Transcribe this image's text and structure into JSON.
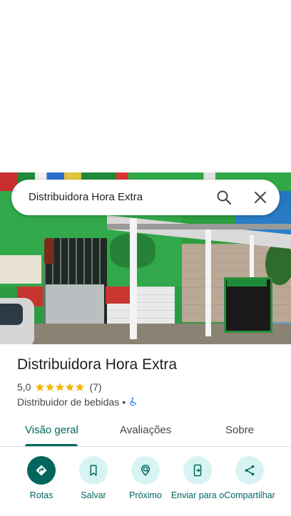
{
  "search": {
    "query": "Distribuidora Hora Extra"
  },
  "place": {
    "name": "Distribuidora Hora Extra",
    "rating": "5,0",
    "stars": 5,
    "review_count": "(7)",
    "category": "Distribuidor de bebidas",
    "separator": "•"
  },
  "tabs": [
    {
      "label": "Visão geral",
      "active": true
    },
    {
      "label": "Avaliações",
      "active": false
    },
    {
      "label": "Sobre",
      "active": false
    }
  ],
  "actions": [
    {
      "label": "Rotas",
      "icon": "directions-icon"
    },
    {
      "label": "Salvar",
      "icon": "bookmark-icon"
    },
    {
      "label": "Próximo",
      "icon": "nearby-icon"
    },
    {
      "label": "Enviar para o",
      "icon": "send-to-phone-icon"
    },
    {
      "label": "Compartilhar",
      "icon": "share-icon"
    }
  ],
  "colors": {
    "accent": "#00665e",
    "accent_light": "#d7f4f3",
    "star": "#f4b400",
    "accessibility": "#1a73e8"
  }
}
